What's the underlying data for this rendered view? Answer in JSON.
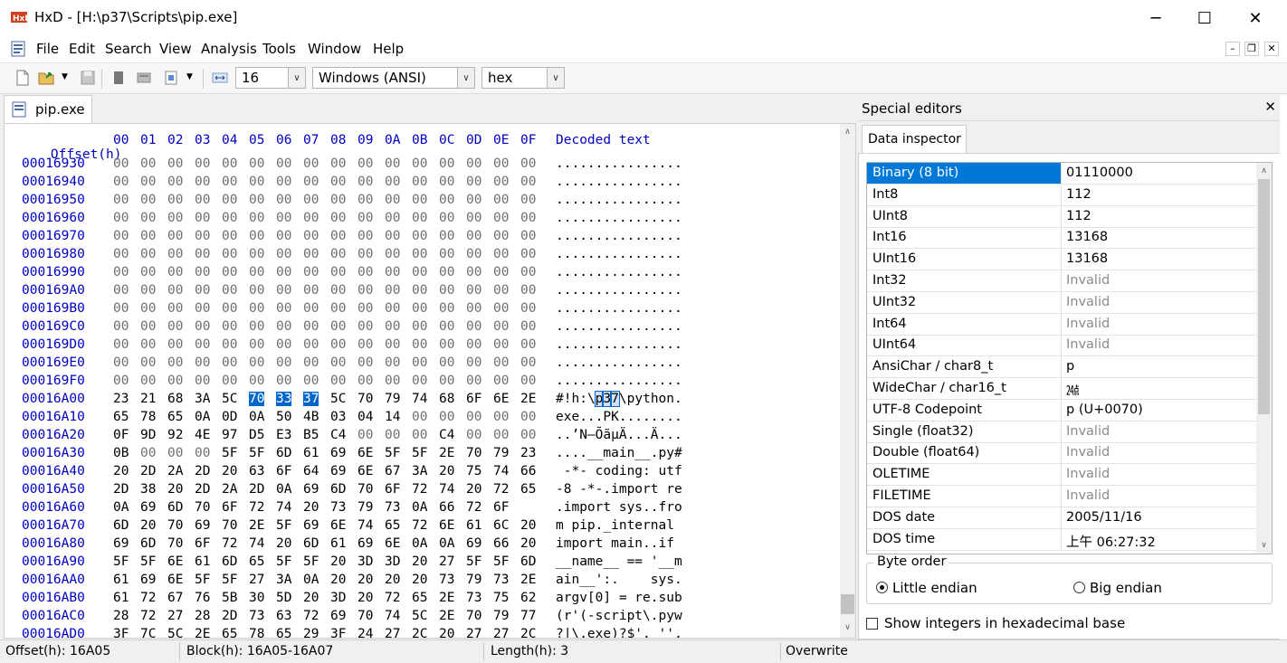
{
  "window": {
    "title": "HxD - [H:\\p37\\Scripts\\pip.exe]",
    "app_icon": "hxd-app-icon",
    "minimize": "─",
    "maximize": "☐",
    "close": "✕"
  },
  "menu": [
    "File",
    "Edit",
    "Search",
    "View",
    "Analysis",
    "Tools",
    "Window",
    "Help"
  ],
  "mdi_controls": {
    "minimize": "–",
    "restore": "❐",
    "close": "✕"
  },
  "toolbar": {
    "bytes_per_row": "16",
    "charset": "Windows (ANSI)",
    "base": "hex"
  },
  "document_tab": "pip.exe",
  "hex_header": {
    "offset_label": "Offset(h)",
    "columns": [
      "00",
      "01",
      "02",
      "03",
      "04",
      "05",
      "06",
      "07",
      "08",
      "09",
      "0A",
      "0B",
      "0C",
      "0D",
      "0E",
      "0F"
    ],
    "text_label": "Decoded text"
  },
  "rows": [
    {
      "offset": "00016930",
      "bytes": [
        "00",
        "00",
        "00",
        "00",
        "00",
        "00",
        "00",
        "00",
        "00",
        "00",
        "00",
        "00",
        "00",
        "00",
        "00",
        "00"
      ],
      "text": "................"
    },
    {
      "offset": "00016940",
      "bytes": [
        "00",
        "00",
        "00",
        "00",
        "00",
        "00",
        "00",
        "00",
        "00",
        "00",
        "00",
        "00",
        "00",
        "00",
        "00",
        "00"
      ],
      "text": "................"
    },
    {
      "offset": "00016950",
      "bytes": [
        "00",
        "00",
        "00",
        "00",
        "00",
        "00",
        "00",
        "00",
        "00",
        "00",
        "00",
        "00",
        "00",
        "00",
        "00",
        "00"
      ],
      "text": "................"
    },
    {
      "offset": "00016960",
      "bytes": [
        "00",
        "00",
        "00",
        "00",
        "00",
        "00",
        "00",
        "00",
        "00",
        "00",
        "00",
        "00",
        "00",
        "00",
        "00",
        "00"
      ],
      "text": "................"
    },
    {
      "offset": "00016970",
      "bytes": [
        "00",
        "00",
        "00",
        "00",
        "00",
        "00",
        "00",
        "00",
        "00",
        "00",
        "00",
        "00",
        "00",
        "00",
        "00",
        "00"
      ],
      "text": "................"
    },
    {
      "offset": "00016980",
      "bytes": [
        "00",
        "00",
        "00",
        "00",
        "00",
        "00",
        "00",
        "00",
        "00",
        "00",
        "00",
        "00",
        "00",
        "00",
        "00",
        "00"
      ],
      "text": "................"
    },
    {
      "offset": "00016990",
      "bytes": [
        "00",
        "00",
        "00",
        "00",
        "00",
        "00",
        "00",
        "00",
        "00",
        "00",
        "00",
        "00",
        "00",
        "00",
        "00",
        "00"
      ],
      "text": "................"
    },
    {
      "offset": "000169A0",
      "bytes": [
        "00",
        "00",
        "00",
        "00",
        "00",
        "00",
        "00",
        "00",
        "00",
        "00",
        "00",
        "00",
        "00",
        "00",
        "00",
        "00"
      ],
      "text": "................"
    },
    {
      "offset": "000169B0",
      "bytes": [
        "00",
        "00",
        "00",
        "00",
        "00",
        "00",
        "00",
        "00",
        "00",
        "00",
        "00",
        "00",
        "00",
        "00",
        "00",
        "00"
      ],
      "text": "................"
    },
    {
      "offset": "000169C0",
      "bytes": [
        "00",
        "00",
        "00",
        "00",
        "00",
        "00",
        "00",
        "00",
        "00",
        "00",
        "00",
        "00",
        "00",
        "00",
        "00",
        "00"
      ],
      "text": "................"
    },
    {
      "offset": "000169D0",
      "bytes": [
        "00",
        "00",
        "00",
        "00",
        "00",
        "00",
        "00",
        "00",
        "00",
        "00",
        "00",
        "00",
        "00",
        "00",
        "00",
        "00"
      ],
      "text": "................"
    },
    {
      "offset": "000169E0",
      "bytes": [
        "00",
        "00",
        "00",
        "00",
        "00",
        "00",
        "00",
        "00",
        "00",
        "00",
        "00",
        "00",
        "00",
        "00",
        "00",
        "00"
      ],
      "text": "................"
    },
    {
      "offset": "000169F0",
      "bytes": [
        "00",
        "00",
        "00",
        "00",
        "00",
        "00",
        "00",
        "00",
        "00",
        "00",
        "00",
        "00",
        "00",
        "00",
        "00",
        "00"
      ],
      "text": "................"
    },
    {
      "offset": "00016A00",
      "bytes": [
        "23",
        "21",
        "68",
        "3A",
        "5C",
        "70",
        "33",
        "37",
        "5C",
        "70",
        "79",
        "74",
        "68",
        "6F",
        "6E",
        "2E"
      ],
      "text": "#!h:\\p37\\python.",
      "selected": [
        5,
        6,
        7
      ]
    },
    {
      "offset": "00016A10",
      "bytes": [
        "65",
        "78",
        "65",
        "0A",
        "0D",
        "0A",
        "50",
        "4B",
        "03",
        "04",
        "14",
        "00",
        "00",
        "00",
        "00",
        "00"
      ],
      "text": "exe...PK........"
    },
    {
      "offset": "00016A20",
      "bytes": [
        "0F",
        "9D",
        "92",
        "4E",
        "97",
        "D5",
        "E3",
        "B5",
        "C4",
        "00",
        "00",
        "00",
        "C4",
        "00",
        "00",
        "00"
      ],
      "text": "..’N—ÕãµÄ...Ä..."
    },
    {
      "offset": "00016A30",
      "bytes": [
        "0B",
        "00",
        "00",
        "00",
        "5F",
        "5F",
        "6D",
        "61",
        "69",
        "6E",
        "5F",
        "5F",
        "2E",
        "70",
        "79",
        "23"
      ],
      "text": "....__main__.py#"
    },
    {
      "offset": "00016A40",
      "bytes": [
        "20",
        "2D",
        "2A",
        "2D",
        "20",
        "63",
        "6F",
        "64",
        "69",
        "6E",
        "67",
        "3A",
        "20",
        "75",
        "74",
        "66"
      ],
      "text": " -*- coding: utf"
    },
    {
      "offset": "00016A50",
      "bytes": [
        "2D",
        "38",
        "20",
        "2D",
        "2A",
        "2D",
        "0A",
        "69",
        "6D",
        "70",
        "6F",
        "72",
        "74",
        "20",
        "72",
        "65"
      ],
      "text": "-8 -*-.import re"
    },
    {
      "offset": "00016A60",
      "bytes": [
        "0A",
        "69",
        "6D",
        "70",
        "6F",
        "72",
        "74",
        "20",
        "73",
        "79",
        "73",
        "0A",
        "66",
        "72",
        "6F"
      ],
      "text": ".import sys..fro"
    },
    {
      "offset": "00016A70",
      "bytes": [
        "6D",
        "20",
        "70",
        "69",
        "70",
        "2E",
        "5F",
        "69",
        "6E",
        "74",
        "65",
        "72",
        "6E",
        "61",
        "6C",
        "20"
      ],
      "text": "m pip._internal "
    },
    {
      "offset": "00016A80",
      "bytes": [
        "69",
        "6D",
        "70",
        "6F",
        "72",
        "74",
        "20",
        "6D",
        "61",
        "69",
        "6E",
        "0A",
        "0A",
        "69",
        "66",
        "20"
      ],
      "text": "import main..if "
    },
    {
      "offset": "00016A90",
      "bytes": [
        "5F",
        "5F",
        "6E",
        "61",
        "6D",
        "65",
        "5F",
        "5F",
        "20",
        "3D",
        "3D",
        "20",
        "27",
        "5F",
        "5F",
        "6D"
      ],
      "text": "__name__ == '__m"
    },
    {
      "offset": "00016AA0",
      "bytes": [
        "61",
        "69",
        "6E",
        "5F",
        "5F",
        "27",
        "3A",
        "0A",
        "20",
        "20",
        "20",
        "20",
        "73",
        "79",
        "73",
        "2E"
      ],
      "text": "ain__':.    sys."
    },
    {
      "offset": "00016AB0",
      "bytes": [
        "61",
        "72",
        "67",
        "76",
        "5B",
        "30",
        "5D",
        "20",
        "3D",
        "20",
        "72",
        "65",
        "2E",
        "73",
        "75",
        "62"
      ],
      "text": "argv[0] = re.sub"
    },
    {
      "offset": "00016AC0",
      "bytes": [
        "28",
        "72",
        "27",
        "28",
        "2D",
        "73",
        "63",
        "72",
        "69",
        "70",
        "74",
        "5C",
        "2E",
        "70",
        "79",
        "77"
      ],
      "text": "(r'(-script\\.pyw"
    },
    {
      "offset": "00016AD0",
      "bytes": [
        "3F",
        "7C",
        "5C",
        "2E",
        "65",
        "78",
        "65",
        "29",
        "3F",
        "24",
        "27",
        "2C",
        "20",
        "27",
        "27",
        "2C"
      ],
      "text": "?|\\.exe)?$', '',"
    }
  ],
  "status": {
    "offset": "Offset(h): 16A05",
    "block": "Block(h): 16A05-16A07",
    "length": "Length(h): 3",
    "mode": "Overwrite"
  },
  "side": {
    "title": "Special editors",
    "close": "✕",
    "tab": "Data inspector",
    "inspector": [
      {
        "k": "Binary (8 bit)",
        "v": "01110000"
      },
      {
        "k": "Int8",
        "v": "112"
      },
      {
        "k": "UInt8",
        "v": "112"
      },
      {
        "k": "Int16",
        "v": "13168"
      },
      {
        "k": "UInt16",
        "v": "13168"
      },
      {
        "k": "Int32",
        "v": "Invalid"
      },
      {
        "k": "UInt32",
        "v": "Invalid"
      },
      {
        "k": "Int64",
        "v": "Invalid"
      },
      {
        "k": "UInt64",
        "v": "Invalid"
      },
      {
        "k": "AnsiChar / char8_t",
        "v": "p"
      },
      {
        "k": "WideChar / char16_t",
        "v": "㍰"
      },
      {
        "k": "UTF-8 Codepoint",
        "v": "p (U+0070)"
      },
      {
        "k": "Single (float32)",
        "v": "Invalid"
      },
      {
        "k": "Double (float64)",
        "v": "Invalid"
      },
      {
        "k": "OLETIME",
        "v": "Invalid"
      },
      {
        "k": "FILETIME",
        "v": "Invalid"
      },
      {
        "k": "DOS date",
        "v": "2005/11/16"
      },
      {
        "k": "DOS time",
        "v": "上午 06:27:32"
      }
    ],
    "byte_order_label": "Byte order",
    "little_endian": "Little endian",
    "big_endian": "Big endian",
    "hex_checkbox": "Show integers in hexadecimal base"
  },
  "colors": {
    "offset_blue": "#0000c0",
    "selection": "#0066cc",
    "row_select": "#0078d7"
  }
}
